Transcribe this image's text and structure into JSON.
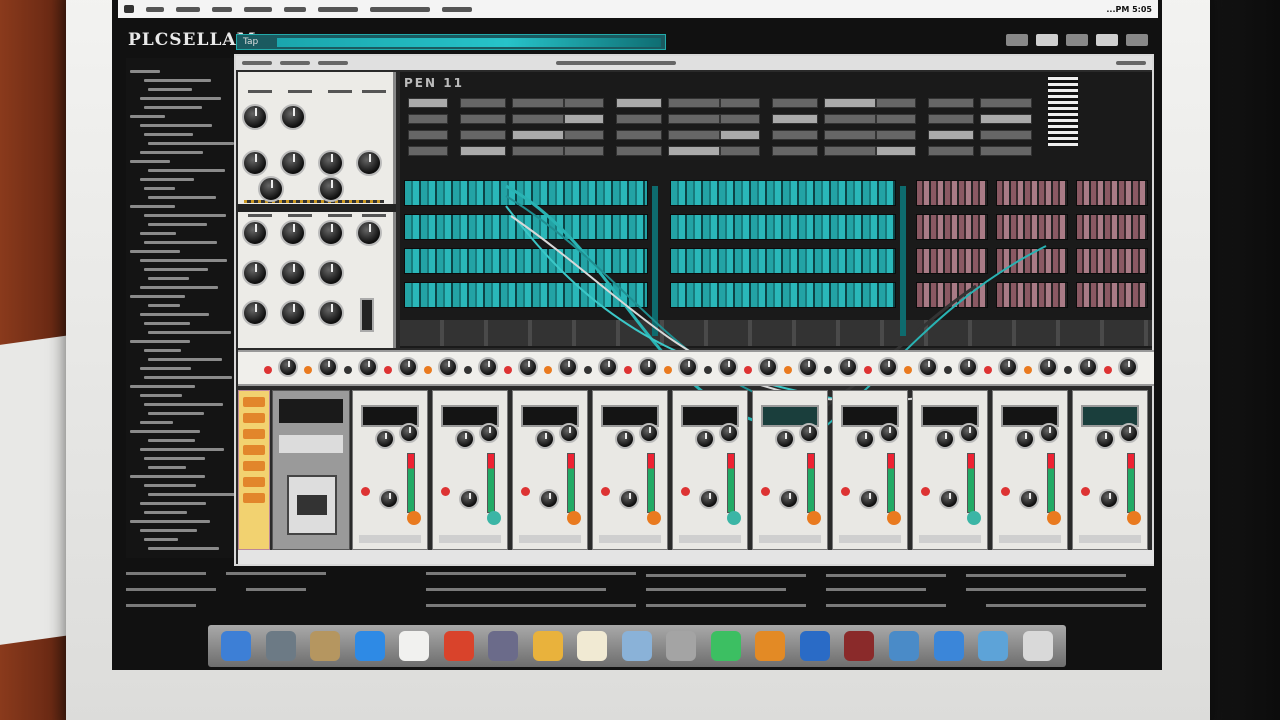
{
  "menubar": {
    "clock": "...PM 5:05"
  },
  "app": {
    "title": "PLCSELLAM"
  },
  "transport": {
    "tempo_label": "Tap"
  },
  "sequencer": {
    "toolbar_label": "PEN 11"
  },
  "colors": {
    "accent_teal": "#26c3c9",
    "pattern_pink": "#a97b86",
    "meter_red": "#e22233",
    "knob_orange": "#e97a1f"
  },
  "mixer": {
    "channels": [
      "ch1",
      "ch2",
      "ch3",
      "ch4",
      "ch5",
      "ch6",
      "ch7",
      "ch8",
      "ch9",
      "ch10"
    ]
  },
  "dock": {
    "items": [
      {
        "name": "finder-icon",
        "color": "#3d7fd6"
      },
      {
        "name": "safari-icon",
        "color": "#6c7a85"
      },
      {
        "name": "contacts-icon",
        "color": "#b59660"
      },
      {
        "name": "folder-icon",
        "color": "#2e8ae5"
      },
      {
        "name": "notes-icon",
        "color": "#f1f1ef"
      },
      {
        "name": "photo-booth-icon",
        "color": "#d9432b"
      },
      {
        "name": "itunes-icon",
        "color": "#6b6b8a"
      },
      {
        "name": "stickies-icon",
        "color": "#e9b23c"
      },
      {
        "name": "textedit-icon",
        "color": "#f1ead3"
      },
      {
        "name": "preview-icon",
        "color": "#8ab2d8"
      },
      {
        "name": "disk-utility-icon",
        "color": "#a4a4a4"
      },
      {
        "name": "facetime-icon",
        "color": "#3cbf62"
      },
      {
        "name": "game-icon",
        "color": "#e38a25"
      },
      {
        "name": "app-store-icon",
        "color": "#2a6bc6"
      },
      {
        "name": "chrome-icon",
        "color": "#8a2a2a"
      },
      {
        "name": "mail-icon",
        "color": "#4a8bc8"
      },
      {
        "name": "network-icon",
        "color": "#3b86d9"
      },
      {
        "name": "monitor-icon",
        "color": "#5da3d8"
      },
      {
        "name": "trash-icon",
        "color": "#d9d9d9"
      }
    ]
  }
}
